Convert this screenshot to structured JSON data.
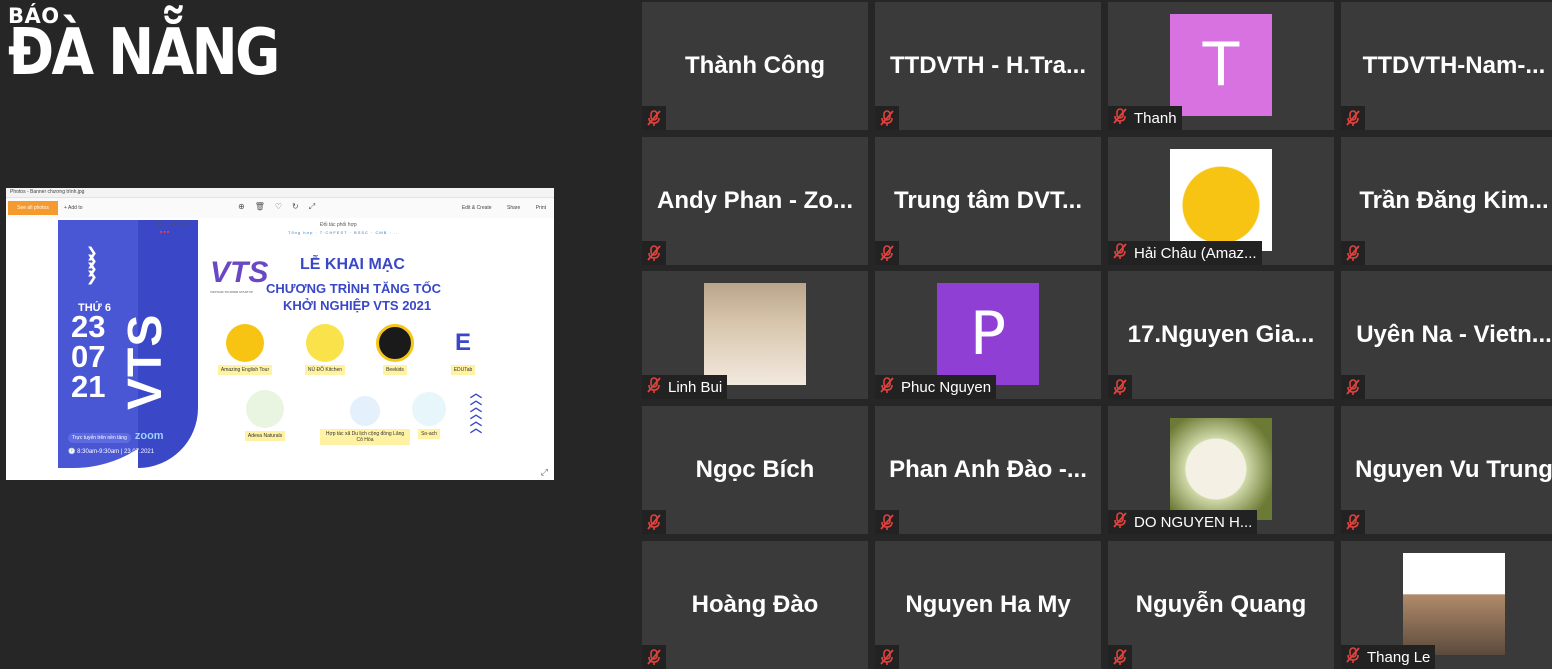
{
  "logo": {
    "line1": "BÁO",
    "line2": "ĐÀ NẴNG"
  },
  "share": {
    "window_title": "Photos - Banner chương trình.jpg",
    "btn_all_photos": "See all photos",
    "btn_add": "+ Add to",
    "edit_create": "Edit & Create",
    "share": "Share",
    "print": "Print",
    "org_label": "Đơn vị tổ chức",
    "partner_label": "Đối tác phối hợp",
    "partner_logos": "Tổng hợp · T·CHFEST · BSSC · CMB · ...",
    "vts_logo": "VTS",
    "vts_sub": "VIETNAM TOURISM STARTUP",
    "headline1": "LỄ KHAI MẠC",
    "headline2": "CHƯƠNG TRÌNH TĂNG TỐC",
    "headline3": "KHỞI NGHIỆP VTS 2021",
    "weekday": "THỨ 6",
    "date_d": "23",
    "date_m": "07",
    "date_y": "21",
    "vertical_text": "VTS",
    "live_text": "Trực tuyến trên nền tảng",
    "zoom_text": "zoom",
    "time_text": "8:30am-9:30am | 23.07.2021",
    "startups": [
      "Amazing English Tour",
      "NÚ ĐỖ Kitchen",
      "Beekids",
      "EDUTab",
      "Adeva Naturals",
      "Hợp tác xã Du lịch cộng đồng Lăng Cô Hòa",
      "So-ach"
    ]
  },
  "participants": [
    {
      "name": "Thành Công"
    },
    {
      "name": "TTDVTH - H.Tra..."
    },
    {
      "name": "Thanh",
      "avatar": "T"
    },
    {
      "name": "TTDVTH-Nam-..."
    },
    {
      "name": "Andy Phan - Zo..."
    },
    {
      "name": "Trung tâm DVT..."
    },
    {
      "name": "Hải Châu (Amaz...",
      "photo": "amazing-english-tour-logo"
    },
    {
      "name": "Trần Đăng Kim..."
    },
    {
      "name": "Linh Bui",
      "photo": "woman-portrait"
    },
    {
      "name": "Phuc Nguyen",
      "avatar": "P"
    },
    {
      "name": "17.Nguyen Gia..."
    },
    {
      "name": "Uyên Na - Vietn..."
    },
    {
      "name": "Ngọc Bích"
    },
    {
      "name": "Phan Anh Đào -..."
    },
    {
      "name": "DO NGUYEN H...",
      "photo": "white-rose"
    },
    {
      "name": "Nguyen Vu Trung"
    },
    {
      "name": "Hoàng Đào"
    },
    {
      "name": "Nguyen Ha My"
    },
    {
      "name": "Nguyễn Quang"
    },
    {
      "name": "Thang Le",
      "photo": "man-on-motorbike"
    }
  ],
  "icons": {
    "muted": "mic-muted-icon"
  },
  "colors": {
    "tile_bg": "#3a3a3a",
    "page_bg": "#262626",
    "muted_red": "#e0433e"
  }
}
